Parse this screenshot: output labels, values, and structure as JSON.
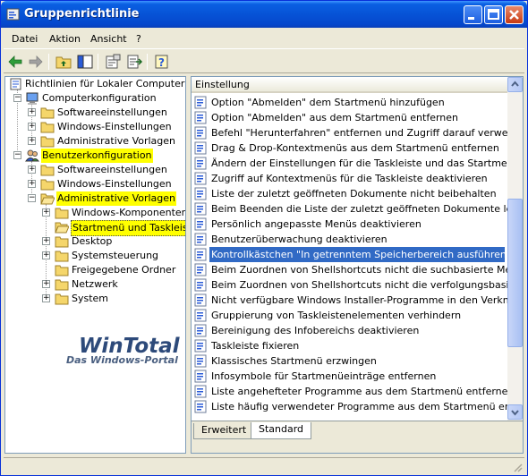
{
  "window": {
    "title": "Gruppenrichtlinie",
    "controls": [
      "minimize",
      "maximize",
      "close"
    ]
  },
  "menubar": {
    "items": [
      "Datei",
      "Aktion",
      "Ansicht",
      "?"
    ]
  },
  "toolbar": {
    "icons": [
      "back-arrow-icon",
      "forward-arrow-icon",
      "up-folder-icon",
      "show-hide-tree-icon",
      "properties-icon",
      "export-list-icon",
      "help-icon"
    ]
  },
  "tree": {
    "root": "Richtlinien für Lokaler Computer",
    "computer": {
      "label": "Computerkonfiguration",
      "children": [
        "Softwareeinstellungen",
        "Windows-Einstellungen",
        "Administrative Vorlagen"
      ]
    },
    "user": {
      "label": "Benutzerkonfiguration",
      "children": [
        "Softwareeinstellungen",
        "Windows-Einstellungen",
        "Administrative Vorlagen"
      ],
      "admin_children": [
        "Windows-Komponenten",
        "Startmenü und Taskleiste",
        "Desktop",
        "Systemsteuerung",
        "Freigegebene Ordner",
        "Netzwerk",
        "System"
      ]
    }
  },
  "watermark": {
    "brand": "WinTotal",
    "tagline": "Das Windows-Portal"
  },
  "list": {
    "header": "Einstellung",
    "selected_index": 10,
    "items": [
      "Option \"Abmelden\" dem Startmenü hinzufügen",
      "Option \"Abmelden\" aus dem Startmenü entfernen",
      "Befehl \"Herunterfahren\" entfernen und Zugriff darauf verweigern",
      "Drag & Drop-Kontextmenüs aus dem Startmenü entfernen",
      "Ändern der Einstellungen für die Taskleiste und das Startmenü ve...",
      "Zugriff auf Kontextmenüs für die Taskleiste deaktivieren",
      "Liste der zuletzt geöffneten Dokumente nicht beibehalten",
      "Beim Beenden die Liste der zuletzt geöffneten Dokumente leeren",
      "Persönlich angepasste Menüs deaktivieren",
      "Benutzerüberwachung deaktivieren",
      "Kontrollkästchen \"In getrenntem Speicherbereich ausführen\" im Di...",
      "Beim Zuordnen von Shellshortcuts nicht die suchbasierte Methode...",
      "Beim Zuordnen von Shellshortcuts nicht die verfolgungsbasierte M...",
      "Nicht verfügbare Windows Installer-Programme in den Verknüpfu...",
      "Gruppierung von Taskleistenelementen verhindern",
      "Bereinigung des Infobereichs deaktivieren",
      "Taskleiste fixieren",
      "Klassisches Startmenü erzwingen",
      "Infosymbole für Startmenüeinträge entfernen",
      "Liste angehefteter Programme aus dem Startmenü entfernen",
      "Liste häufig verwendeter Programme aus dem Startmenü entfernen"
    ]
  },
  "tabs": [
    "Erweitert",
    "Standard"
  ],
  "active_tab": "Standard",
  "colors": {
    "title_bar": "#0653d6",
    "selection": "#316ac5",
    "highlight": "#ffff00"
  }
}
